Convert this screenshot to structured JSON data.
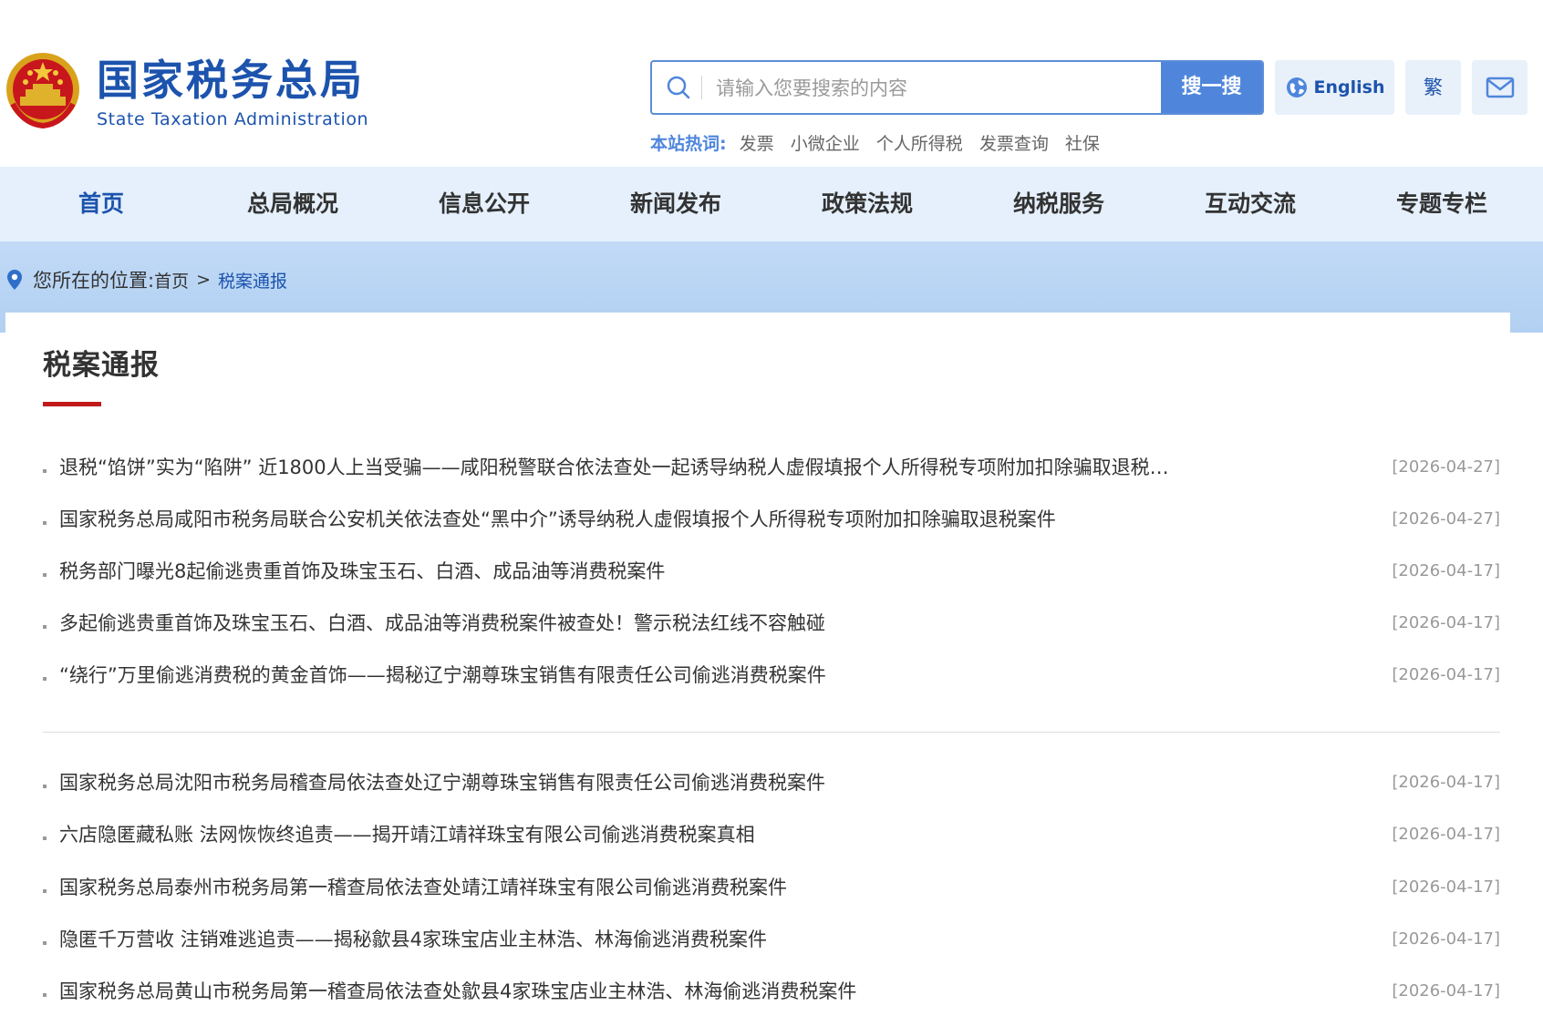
{
  "header": {
    "logo_cn": "国家税务总局",
    "logo_en": "State Taxation Administration",
    "search": {
      "placeholder": "请输入您要搜索的内容",
      "button_label": "搜一搜"
    },
    "english_label": "English",
    "traditional_label": "繁",
    "hotwords": {
      "label": "本站热词:",
      "items": [
        "发票",
        "小微企业",
        "个人所得税",
        "发票查询",
        "社保"
      ]
    }
  },
  "nav": {
    "items": [
      {
        "label": "首页"
      },
      {
        "label": "总局概况"
      },
      {
        "label": "信息公开"
      },
      {
        "label": "新闻发布"
      },
      {
        "label": "政策法规"
      },
      {
        "label": "纳税服务"
      },
      {
        "label": "互动交流"
      },
      {
        "label": "专题专栏"
      }
    ],
    "active": "首页"
  },
  "breadcrumb": {
    "label": "您所在的位置:",
    "home": "首页",
    "separator": ">",
    "current": "税案通报"
  },
  "section": {
    "title": "税案通报"
  },
  "news": [
    {
      "title": "退税“馅饼”实为“陷阱” 近1800人上当受骗——咸阳税警联合依法查处一起诱导纳税人虚假填报个人所得税专项附加扣除骗取退税…",
      "date": "[2026-04-27]"
    },
    {
      "title": "国家税务总局咸阳市税务局联合公安机关依法查处“黑中介”诱导纳税人虚假填报个人所得税专项附加扣除骗取退税案件",
      "date": "[2026-04-27]"
    },
    {
      "title": "税务部门曝光8起偷逃贵重首饰及珠宝玉石、白酒、成品油等消费税案件",
      "date": "[2026-04-17]"
    },
    {
      "title": "多起偷逃贵重首饰及珠宝玉石、白酒、成品油等消费税案件被查处！警示税法红线不容触碰",
      "date": "[2026-04-17]"
    },
    {
      "title": "“绕行”万里偷逃消费税的黄金首饰——揭秘辽宁潮尊珠宝销售有限责任公司偷逃消费税案件",
      "date": "[2026-04-17]"
    },
    {
      "title": "国家税务总局沈阳市税务局稽查局依法查处辽宁潮尊珠宝销售有限责任公司偷逃消费税案件",
      "date": "[2026-04-17]"
    },
    {
      "title": "六店隐匿藏私账 法网恢恢终追责——揭开靖江靖祥珠宝有限公司偷逃消费税案真相",
      "date": "[2026-04-17]"
    },
    {
      "title": "国家税务总局泰州市税务局第一稽查局依法查处靖江靖祥珠宝有限公司偷逃消费税案件",
      "date": "[2026-04-17]"
    },
    {
      "title": "隐匿千万营收 注销难逃追责——揭秘歙县4家珠宝店业主林浩、林海偷逃消费税案件",
      "date": "[2026-04-17]"
    },
    {
      "title": "国家税务总局黄山市税务局第一稽查局依法查处歙县4家珠宝店业主林浩、林海偷逃消费税案件",
      "date": "[2026-04-17]"
    }
  ],
  "colors": {
    "brand_blue": "#1c53ad",
    "button_blue": "#4f86dc",
    "nav_bg": "#e5f0fc",
    "crumb_band": "#b8d4f4",
    "accent_red": "#c21a1a"
  }
}
